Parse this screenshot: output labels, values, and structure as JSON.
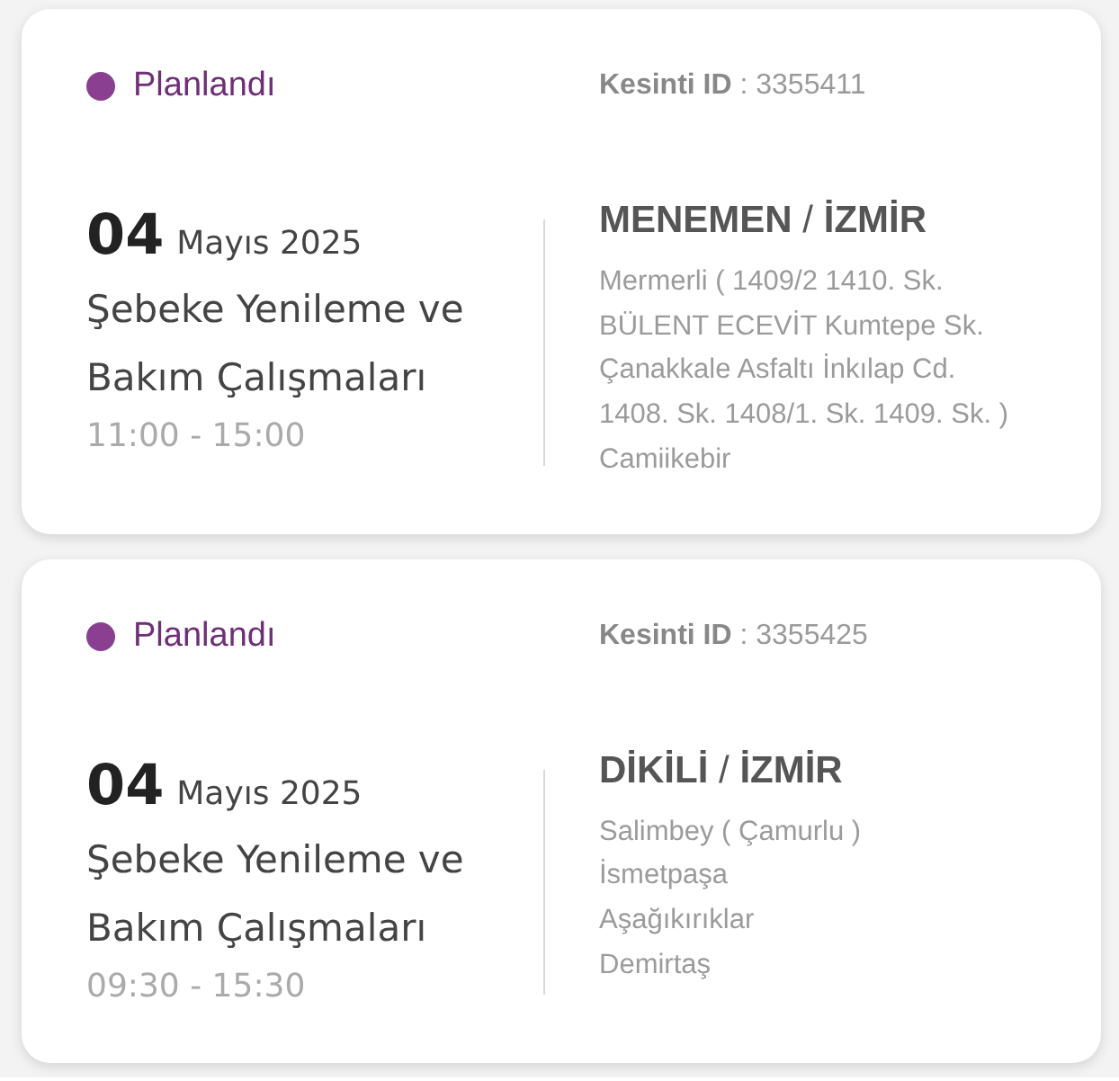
{
  "outages": [
    {
      "status": {
        "label": "Planlandı",
        "color": "#8b3f91"
      },
      "outage_id": "**Kesinti ID** : 3355411",
      "date": {
        "day": "04",
        "month_year": "Mayıs 2025"
      },
      "title": "Şebeke Yenileme ve Bakım Çalışmaları",
      "time": "11:00 - 15:00",
      "district": "**MENEMEN** / **İZMİR**",
      "neighborhoods": [
        "Mermerli ( 1409/2 1410. Sk. BÜLENT ECEVİT Kumtepe Sk. Çanakkale Asfaltı İnkılap Cd. 1408. Sk. 1408/1. Sk. 1409. Sk. )",
        "Camiikebir"
      ]
    },
    {
      "status": {
        "label": "Planlandı",
        "color": "#8b3f91"
      },
      "outage_id": "**Kesinti ID** : 3355425",
      "date": {
        "day": "04",
        "month_year": "Mayıs 2025"
      },
      "title": "Şebeke Yenileme ve Bakım Çalışmaları",
      "time": "09:30 - 15:30",
      "district": "**DİKİLİ** / **İZMİR**",
      "neighborhoods": [
        "Salimbey ( Çamurlu )",
        "İsmetpaşa",
        "Aşağıkırıklar",
        "Demirtaş"
      ]
    }
  ]
}
